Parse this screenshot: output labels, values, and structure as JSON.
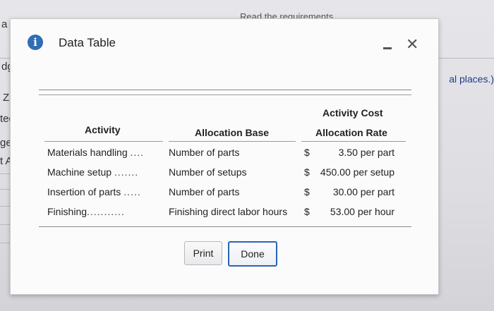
{
  "background": {
    "top_text": "Read the requirements",
    "left_fragments": [
      "a",
      "dg",
      "Z",
      "ted",
      "get",
      "t Al"
    ],
    "right_fragment": "al places.)"
  },
  "dialog": {
    "title": "Data Table",
    "icon": "info-icon",
    "headers": {
      "activity": "Activity",
      "allocation_base": "Allocation Base",
      "activity_cost": "Activity Cost",
      "allocation_rate": "Allocation Rate"
    },
    "rows": [
      {
        "activity": "Materials handling",
        "dots": "....",
        "base": "Number of parts",
        "dollar": "$",
        "rate": "3.50 per part"
      },
      {
        "activity": "Machine setup",
        "dots": ".......",
        "base": "Number of setups",
        "dollar": "$",
        "rate": "450.00 per setup"
      },
      {
        "activity": "Insertion of parts",
        "dots": ".....",
        "base": "Number of parts",
        "dollar": "$",
        "rate": "30.00 per part"
      },
      {
        "activity": "Finishing",
        "dots": "...........",
        "base": "Finishing direct labor hours",
        "dollar": "$",
        "rate": "53.00 per hour"
      }
    ],
    "buttons": {
      "print": "Print",
      "done": "Done"
    }
  },
  "colors": {
    "accent": "#2a64b4",
    "info": "#2f6db5"
  }
}
